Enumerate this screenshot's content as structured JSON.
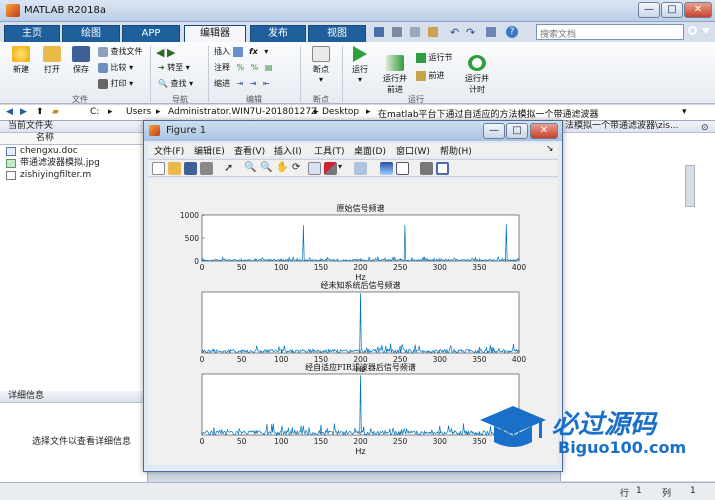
{
  "window": {
    "title": "MATLAB R2018a",
    "min": "—",
    "max": "□",
    "close": "✕"
  },
  "tabs": [
    {
      "label": "主页",
      "active": false
    },
    {
      "label": "绘图",
      "active": false
    },
    {
      "label": "APP",
      "active": false
    },
    {
      "label": "编辑器",
      "active": true
    },
    {
      "label": "发布",
      "active": false
    },
    {
      "label": "视图",
      "active": false
    }
  ],
  "search": {
    "placeholder": "搜索文档"
  },
  "ribbon": {
    "file": {
      "new": "新建",
      "open": "打开",
      "save": "保存",
      "find_files": "查找文件",
      "compare": "比较",
      "print": "打印",
      "group": "文件"
    },
    "nav": {
      "goto": "转至",
      "find": "查找",
      "group": "导航"
    },
    "edit": {
      "insert": "插入",
      "comment": "注释",
      "indent": "缩进",
      "group": "编辑"
    },
    "breakpoints": {
      "label": "断点",
      "group": "断点"
    },
    "run": {
      "run": "运行",
      "run_advance": "运行并\n前进",
      "run_section": "运行节",
      "advance": "前进",
      "run_time": "运行并\n计时",
      "group": "运行"
    }
  },
  "address": {
    "parts": [
      "C:",
      "Users",
      "Administrator.WIN7U-20180127Z",
      "Desktop",
      "在matlab平台下通过自适应的方法模拟一个带通滤波器"
    ]
  },
  "left_panel": {
    "title": "当前文件夹",
    "column": "名称",
    "files": [
      {
        "name": "chengxu.doc",
        "type": "doc"
      },
      {
        "name": "带通滤波器模拟.jpg",
        "type": "jpg"
      },
      {
        "name": "zishiyingfilter.m",
        "type": "m"
      }
    ],
    "details_title": "详细信息",
    "details_hint": "选择文件以查看详细信息"
  },
  "right_panel": {
    "path_text": "法模拟一个带通滤波器\\zis..."
  },
  "status": {
    "row_label": "行",
    "row": "1",
    "col_label": "列",
    "col": "1"
  },
  "figure": {
    "title": "Figure 1",
    "menus": [
      "文件(F)",
      "编辑(E)",
      "查看(V)",
      "插入(I)",
      "工具(T)",
      "桌面(D)",
      "窗口(W)",
      "帮助(H)"
    ]
  },
  "chart_data": [
    {
      "type": "line",
      "title": "原始信号频谱",
      "xlabel": "Hz",
      "xlim": [
        0,
        400
      ],
      "ylim": [
        0,
        1000
      ],
      "xticks": [
        0,
        50,
        100,
        150,
        200,
        250,
        300,
        350,
        400
      ],
      "yticks": [
        0,
        500,
        1000
      ],
      "peaks": [
        {
          "x": 128,
          "y": 780
        },
        {
          "x": 256,
          "y": 790
        },
        {
          "x": 384,
          "y": 810
        }
      ],
      "noise_level": 60,
      "color": "#0072bd"
    },
    {
      "type": "line",
      "title": "经未知系统后信号频谱",
      "xlabel": "Hz",
      "xlim": [
        0,
        400
      ],
      "ylim": [
        0,
        1
      ],
      "xticks": [
        0,
        50,
        100,
        150,
        200,
        250,
        300,
        350,
        400
      ],
      "yticks": [],
      "peaks": [
        {
          "x": 200,
          "y": 0.98
        }
      ],
      "noise_level": 0.1,
      "color": "#0072bd"
    },
    {
      "type": "line",
      "title": "经自适应FIR滤波器后信号频谱",
      "xlabel": "Hz",
      "xlim": [
        0,
        400
      ],
      "ylim": [
        0,
        1
      ],
      "xticks": [
        0,
        50,
        100,
        150,
        200,
        250,
        300,
        350,
        400
      ],
      "yticks": [],
      "peaks": [
        {
          "x": 200,
          "y": 0.98
        },
        {
          "x": 128,
          "y": 0.15
        },
        {
          "x": 300,
          "y": 0.15
        },
        {
          "x": 380,
          "y": 0.12
        }
      ],
      "noise_level": 0.12,
      "color": "#0072bd"
    }
  ],
  "watermark": {
    "brand": "必过源码",
    "site": "Biguo100.com"
  }
}
